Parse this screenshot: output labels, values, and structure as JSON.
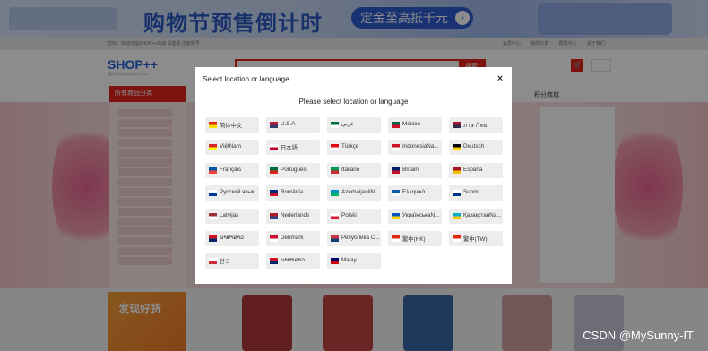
{
  "background": {
    "banner": {
      "headline": "购物节预售倒计时",
      "pill": "定金至高抵千元",
      "pill_go": "›"
    },
    "topbar": {
      "left": "您好，欢迎光临SHOP++商城    请登录    注册账号",
      "right": "会员中心  我的订单  帮助中心  关于我们"
    },
    "logo": "SHOP++",
    "logo_sub": "最优质的电商软件供应商",
    "search": {
      "button": "搜索"
    },
    "cart_icon": "🛒",
    "category_head": "所有商品分类",
    "nav": [
      "积分商城"
    ],
    "promo": "发现好货"
  },
  "modal": {
    "title": "Select location or language",
    "close": "×",
    "subtitle": "Please select location or language",
    "languages": [
      {
        "label": "简体中文",
        "flag": [
          "#de2910",
          "#ffde00"
        ]
      },
      {
        "label": "U.S.A",
        "flag": [
          "#b22234",
          "#3c3b6e"
        ]
      },
      {
        "label": "عربي",
        "flag": [
          "#006c35",
          "#ffffff"
        ]
      },
      {
        "label": "México",
        "flag": [
          "#006847",
          "#ce1126"
        ]
      },
      {
        "label": "ภาษาไทย",
        "flag": [
          "#a51931",
          "#2d2a4a"
        ]
      },
      {
        "label": "ViệtNam",
        "flag": [
          "#da251d",
          "#ffff00"
        ]
      },
      {
        "label": "日本語",
        "flag": [
          "#ffffff",
          "#bc002d"
        ]
      },
      {
        "label": "Türkçe",
        "flag": [
          "#e30a17",
          "#ffffff"
        ]
      },
      {
        "label": "IndonesiaNa...",
        "flag": [
          "#ce1126",
          "#ffffff"
        ]
      },
      {
        "label": "Deutsch",
        "flag": [
          "#000000",
          "#ffce00"
        ]
      },
      {
        "label": "Français",
        "flag": [
          "#0055a4",
          "#ef4135"
        ]
      },
      {
        "label": "Português",
        "flag": [
          "#046a38",
          "#da291c"
        ]
      },
      {
        "label": "Italiano",
        "flag": [
          "#009246",
          "#ce2b37"
        ]
      },
      {
        "label": "Britain",
        "flag": [
          "#012169",
          "#c8102e"
        ]
      },
      {
        "label": "España",
        "flag": [
          "#aa151b",
          "#f1bf00"
        ]
      },
      {
        "label": "Русский язык",
        "flag": [
          "#ffffff",
          "#0039a6"
        ]
      },
      {
        "label": "România",
        "flag": [
          "#002b7f",
          "#ce1126"
        ]
      },
      {
        "label": "AzerbaijanliN...",
        "flag": [
          "#0092bc",
          "#00af66"
        ]
      },
      {
        "label": "Ελληνικά",
        "flag": [
          "#0d5eaf",
          "#ffffff"
        ]
      },
      {
        "label": "Suomi",
        "flag": [
          "#ffffff",
          "#003580"
        ]
      },
      {
        "label": "Latvijas",
        "flag": [
          "#9e3039",
          "#ffffff"
        ]
      },
      {
        "label": "Nederlands",
        "flag": [
          "#ae1c28",
          "#21468b"
        ]
      },
      {
        "label": "Polski",
        "flag": [
          "#ffffff",
          "#dc143c"
        ]
      },
      {
        "label": "УкраїнськаN...",
        "flag": [
          "#0057b7",
          "#ffd700"
        ]
      },
      {
        "label": "ҚазақстанNa...",
        "flag": [
          "#00afca",
          "#fec50c"
        ]
      },
      {
        "label": "ພາສາລາວ",
        "flag": [
          "#ce1126",
          "#002868"
        ]
      },
      {
        "label": "Denmark",
        "flag": [
          "#c8102e",
          "#ffffff"
        ]
      },
      {
        "label": "Република С...",
        "flag": [
          "#c6363c",
          "#0c4076"
        ]
      },
      {
        "label": "繁中(HK)",
        "flag": [
          "#de2910",
          "#ffffff"
        ]
      },
      {
        "label": "繁中(TW)",
        "flag": [
          "#de2910",
          "#ffffff"
        ]
      },
      {
        "label": "한국",
        "flag": [
          "#ffffff",
          "#cd2e3a"
        ]
      },
      {
        "label": "ພາສາລາວ",
        "flag": [
          "#ce1126",
          "#002868"
        ]
      },
      {
        "label": "Malay",
        "flag": [
          "#010066",
          "#cc0001"
        ]
      }
    ]
  },
  "watermark": "CSDN @MySunny-IT"
}
